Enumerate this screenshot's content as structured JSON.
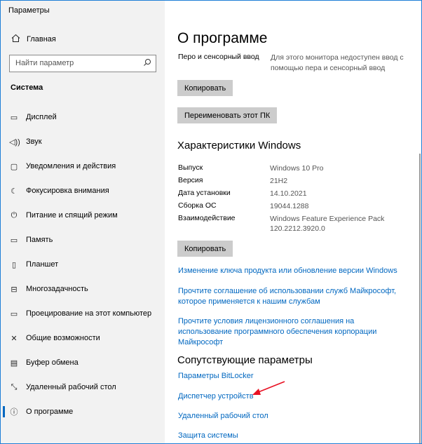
{
  "window": {
    "title": "Параметры"
  },
  "sidebar": {
    "home_label": "Главная",
    "search_placeholder": "Найти параметр",
    "section_title": "Система",
    "items": [
      {
        "label": "Дисплей",
        "icon": "display-icon"
      },
      {
        "label": "Звук",
        "icon": "sound-icon"
      },
      {
        "label": "Уведомления и действия",
        "icon": "notifications-icon"
      },
      {
        "label": "Фокусировка внимания",
        "icon": "focus-assist-icon"
      },
      {
        "label": "Питание и спящий режим",
        "icon": "power-icon"
      },
      {
        "label": "Память",
        "icon": "storage-icon"
      },
      {
        "label": "Планшет",
        "icon": "tablet-icon"
      },
      {
        "label": "Многозадачность",
        "icon": "multitasking-icon"
      },
      {
        "label": "Проецирование на этот компьютер",
        "icon": "projecting-icon"
      },
      {
        "label": "Общие возможности",
        "icon": "shared-experiences-icon"
      },
      {
        "label": "Буфер обмена",
        "icon": "clipboard-icon"
      },
      {
        "label": "Удаленный рабочий стол",
        "icon": "remote-desktop-icon"
      },
      {
        "label": "О программе",
        "icon": "info-icon",
        "selected": true
      }
    ]
  },
  "main": {
    "title": "О программе",
    "pen_label": "Перо и сенсорный ввод",
    "pen_value": "Для этого монитора недоступен ввод с помощью пера и сенсорный ввод",
    "copy_button_1": "Копировать",
    "rename_button": "Переименовать этот ПК",
    "windows_specs_title": "Характеристики Windows",
    "specs": [
      {
        "key": "Выпуск",
        "value": "Windows 10 Pro"
      },
      {
        "key": "Версия",
        "value": "21H2"
      },
      {
        "key": "Дата установки",
        "value": "14.10.2021"
      },
      {
        "key": "Сборка ОС",
        "value": "19044.1288"
      },
      {
        "key": "Взаимодействие",
        "value": "Windows Feature Experience Pack 120.2212.3920.0"
      }
    ],
    "copy_button_2": "Копировать",
    "links": [
      "Изменение ключа продукта или обновление версии Windows",
      "Прочтите соглашение об использовании служб Майкрософт, которое применяется к нашим службам",
      "Прочтите условия лицензионного соглашения на использование программного обеспечения корпорации Майкрософт"
    ],
    "related_title": "Сопутствующие параметры",
    "related_links": [
      "Параметры BitLocker",
      "Диспетчер устройств",
      "Удаленный рабочий стол",
      "Защита системы"
    ]
  },
  "colors": {
    "accent": "#0067c0",
    "annotation_arrow": "#e81123",
    "sidebar_bg": "#f2f2f2",
    "button_bg": "#cccccc"
  }
}
